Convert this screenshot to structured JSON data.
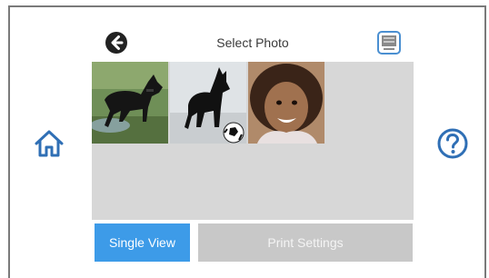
{
  "header": {
    "title": "Select Photo",
    "back_icon": "back-arrow-icon",
    "display_icon": "display-mode-icon"
  },
  "side": {
    "home_icon": "home-icon",
    "help_icon": "help-icon"
  },
  "photos": [
    {
      "subject": "dog-on-grass"
    },
    {
      "subject": "dog-with-ball"
    },
    {
      "subject": "smiling-child"
    }
  ],
  "footer": {
    "single_view_label": "Single View",
    "print_settings_label": "Print Settings"
  },
  "colors": {
    "accent": "#3d9be8",
    "icon_blue": "#2f6fb5",
    "grid_bg": "#d7d7d7",
    "disabled": "#c8c8c8"
  }
}
